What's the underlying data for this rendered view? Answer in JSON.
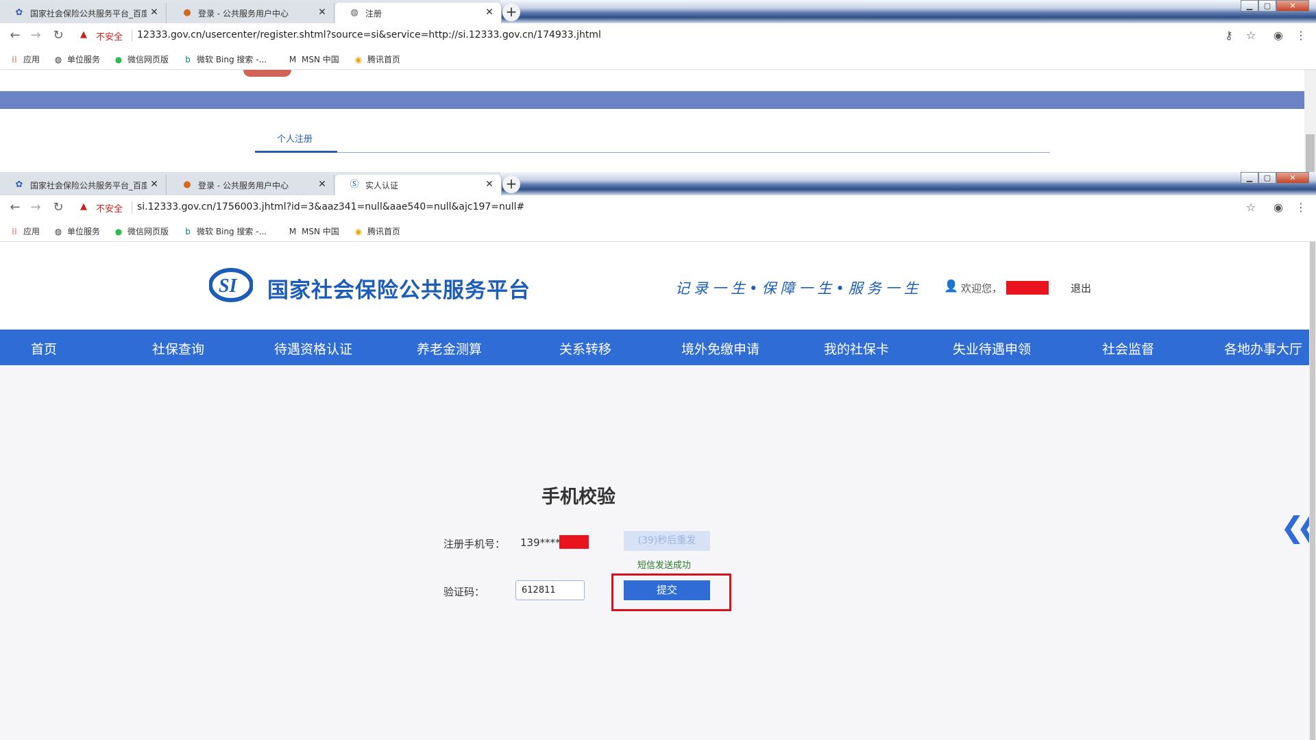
{
  "window1": {
    "tabs": [
      {
        "icon": "paw-icon",
        "title": "国家社会保险公共服务平台_百度"
      },
      {
        "icon": "emblem-icon",
        "title": "登录 - 公共服务用户中心"
      },
      {
        "icon": "globe-icon",
        "title": "注册"
      }
    ],
    "insecure_label": "不安全",
    "url": "12333.gov.cn/usercenter/register.shtml?source=si&service=http://si.12333.gov.cn/174933.jhtml",
    "tab_label": "个人注册"
  },
  "window2": {
    "tabs": [
      {
        "icon": "paw-icon",
        "title": "国家社会保险公共服务平台_百度"
      },
      {
        "icon": "emblem-icon",
        "title": "登录 - 公共服务用户中心"
      },
      {
        "icon": "si-icon",
        "title": "实人认证"
      }
    ],
    "insecure_label": "不安全",
    "url": "si.12333.gov.cn/1756003.jhtml?id=3&aaz341=null&aae540=null&ajc197=null#"
  },
  "bookmarks": [
    {
      "icon": "apps-icon",
      "label": "应用"
    },
    {
      "icon": "globe-icon",
      "label": "单位服务"
    },
    {
      "icon": "wechat-icon",
      "label": "微信网页版"
    },
    {
      "icon": "bing-icon",
      "label": "微软 Bing 搜索 -..."
    },
    {
      "icon": "msn-icon",
      "label": "MSN 中国"
    },
    {
      "icon": "tencent-icon",
      "label": "腾讯首页"
    }
  ],
  "site": {
    "title": "国家社会保险公共服务平台",
    "slogan": "记录一生•保障一生•服务一生",
    "welcome": "欢迎您，",
    "logout": "退出",
    "menu": [
      "首页",
      "社保查询",
      "待遇资格认证",
      "养老金测算",
      "关系转移",
      "境外免缴申请",
      "我的社保卡",
      "失业待遇申领",
      "社会监督",
      "各地办事大厅"
    ]
  },
  "verify": {
    "title": "手机校验",
    "phone_label": "注册手机号：",
    "phone_value": "139****",
    "resend_label": "(39)秒后重发",
    "sent_message": "短信发送成功",
    "code_label": "验证码：",
    "code_value": "612811",
    "submit_label": "提交"
  },
  "colors": {
    "brand_blue": "#2f6cd6",
    "highlight_red": "#d3121c"
  }
}
